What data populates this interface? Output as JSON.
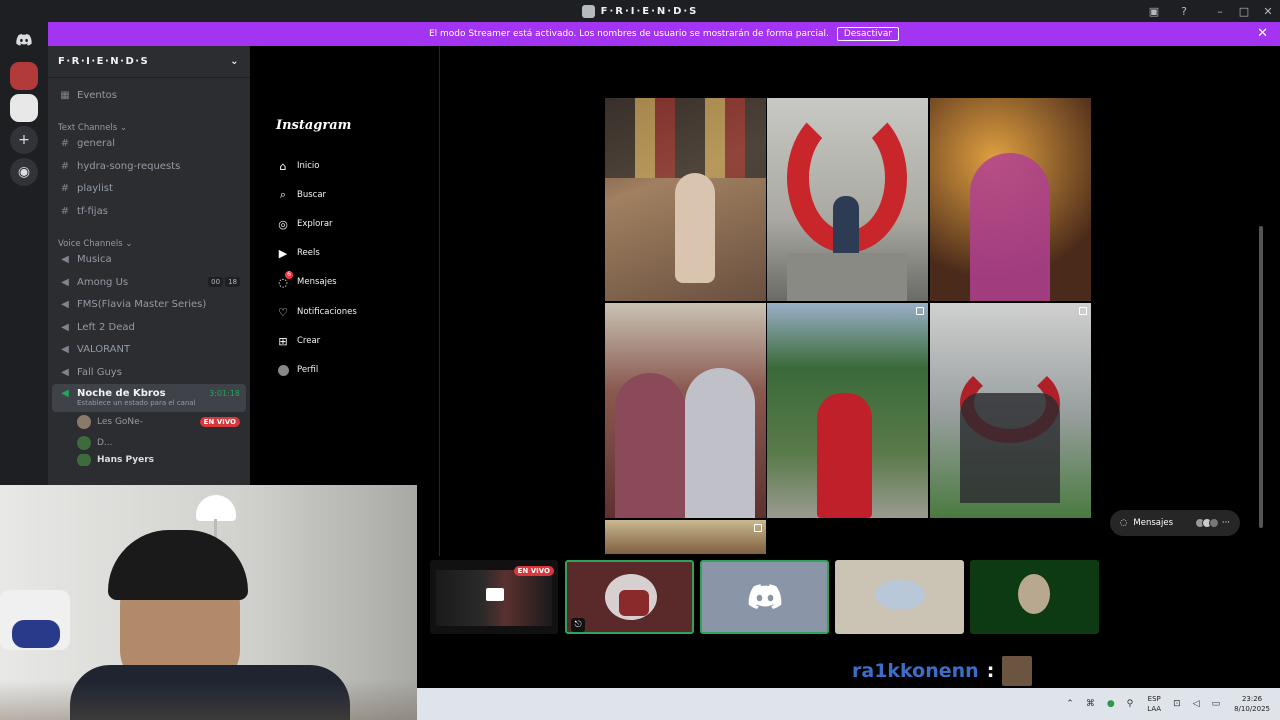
{
  "titlebar": {
    "title": "F·R·I·E·N·D·S"
  },
  "banner": {
    "text": "El modo Streamer está activado. Los nombres de usuario se mostrarán de forma parcial.",
    "button": "Desactivar",
    "close": "✕"
  },
  "server": {
    "name": "F·R·I·E·N·D·S",
    "events": "Eventos",
    "text_category": "Text Channels",
    "text_channels": [
      "general",
      "hydra-song-requests",
      "playlist",
      "tf-fijas"
    ],
    "voice_category": "Voice Channels",
    "voice_channels": [
      "Musica",
      "Among Us",
      "FMS(Flavia Master Series)",
      "Left 2 Dead",
      "VALORANT",
      "Fall Guys"
    ],
    "among_badges": [
      "00",
      "18"
    ],
    "active_voice": {
      "name": "Noche de Kbros",
      "timer": "3:01:18",
      "status": "Establece un estado para el canal"
    },
    "voice_users": [
      {
        "name": "Les GoNe-",
        "live": "EN VIVO"
      },
      {
        "name": "D..."
      },
      {
        "name": "Hans Pyers"
      }
    ]
  },
  "instagram": {
    "logo": "Instagram",
    "nav": [
      "Inicio",
      "Buscar",
      "Explorar",
      "Reels",
      "Mensajes",
      "Notificaciones",
      "Crear",
      "Perfil"
    ],
    "messages_badge": "6",
    "mensajes_pill": "Mensajes",
    "mensajes_more": "···"
  },
  "stream_thumbs": {
    "live": "EN VIVO"
  },
  "chat": {
    "user": "ra1kkonenn",
    "sep": ":"
  },
  "taskbar": {
    "lang1": "ESP",
    "lang2": "LAA",
    "time": "23:26",
    "date": "8/10/2025"
  },
  "colors": {
    "banner": "#a335f2",
    "sidebar": "#2b2d31",
    "guilds": "#1e1f22",
    "live": "#da373c",
    "active_green": "#23a55a"
  }
}
